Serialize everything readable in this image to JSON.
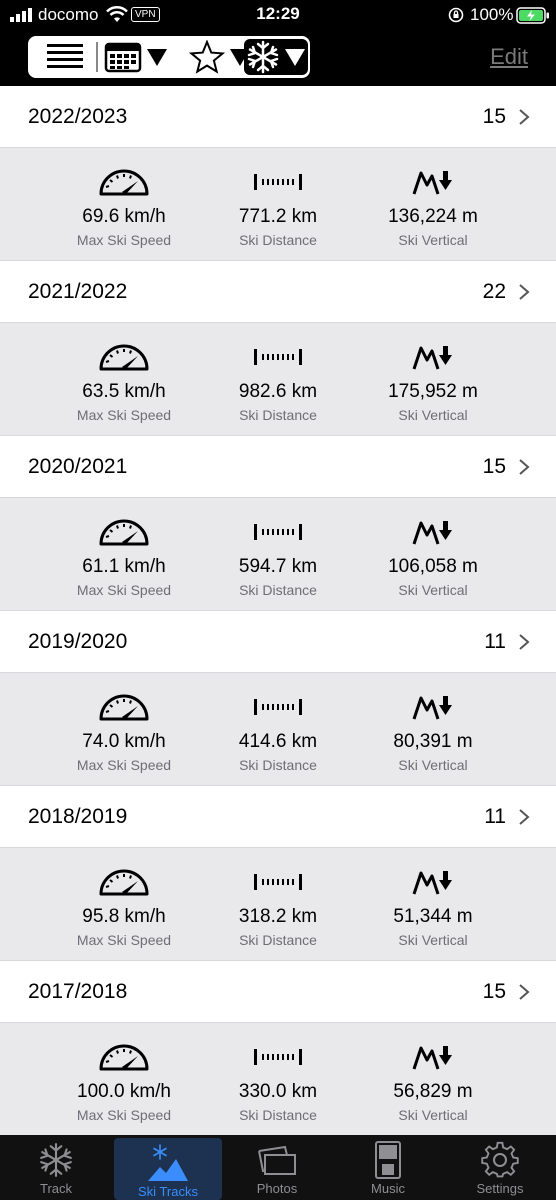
{
  "status_bar": {
    "carrier": "docomo",
    "vpn": "VPN",
    "time": "12:29",
    "battery": "100%"
  },
  "toolbar": {
    "edit_label": "Edit",
    "segments": [
      "list-icon",
      "calendar-icon",
      "star-icon",
      "snowflake-icon"
    ],
    "selected_segment": "snowflake-icon"
  },
  "seasons": [
    {
      "name": "2022/2023",
      "count": "15",
      "speed": "69.6 km/h",
      "distance": "771.2 km",
      "vertical": "136,224 m"
    },
    {
      "name": "2021/2022",
      "count": "22",
      "speed": "63.5 km/h",
      "distance": "982.6 km",
      "vertical": "175,952 m"
    },
    {
      "name": "2020/2021",
      "count": "15",
      "speed": "61.1 km/h",
      "distance": "594.7 km",
      "vertical": "106,058 m"
    },
    {
      "name": "2019/2020",
      "count": "11",
      "speed": "74.0 km/h",
      "distance": "414.6 km",
      "vertical": "80,391 m"
    },
    {
      "name": "2018/2019",
      "count": "11",
      "speed": "95.8 km/h",
      "distance": "318.2 km",
      "vertical": "51,344 m"
    },
    {
      "name": "2017/2018",
      "count": "15",
      "speed": "100.0 km/h",
      "distance": "330.0 km",
      "vertical": "56,829 m"
    }
  ],
  "stat_labels": {
    "speed": "Max Ski Speed",
    "distance": "Ski Distance",
    "vertical": "Ski Vertical"
  },
  "tabs": [
    {
      "label": "Track",
      "icon": "snowflake-icon",
      "active": false
    },
    {
      "label": "Ski Tracks",
      "icon": "ski-mountain-icon",
      "active": true
    },
    {
      "label": "Photos",
      "icon": "photos-icon",
      "active": false
    },
    {
      "label": "Music",
      "icon": "music-player-icon",
      "active": false
    },
    {
      "label": "Settings",
      "icon": "gear-icon",
      "active": false
    }
  ],
  "colors": {
    "accent": "#3b8dfd",
    "tab_active_bg": "#1c3250",
    "stats_bg": "#e9e9ec"
  }
}
